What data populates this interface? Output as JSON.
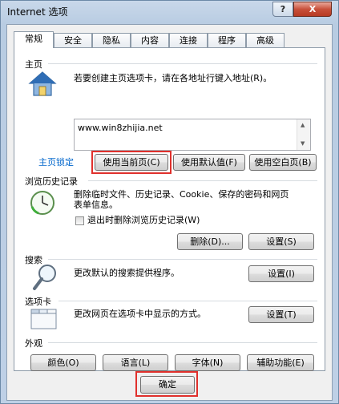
{
  "window": {
    "title": "Internet 选项",
    "help_label": "?",
    "close_label": "X"
  },
  "tabs": [
    {
      "label": "常规",
      "active": true
    },
    {
      "label": "安全"
    },
    {
      "label": "隐私"
    },
    {
      "label": "内容"
    },
    {
      "label": "连接"
    },
    {
      "label": "程序"
    },
    {
      "label": "高级"
    }
  ],
  "homepage": {
    "group_label": "主页",
    "description": "若要创建主页选项卡，请在各地址行键入地址(R)。",
    "url_value": "www.win8zhijia.net",
    "lock_label": "主页锁定",
    "use_current": "使用当前页(C)",
    "use_default": "使用默认值(F)",
    "use_blank": "使用空白页(B)",
    "icon": "house-icon"
  },
  "history": {
    "group_label": "浏览历史记录",
    "description_line1": "删除临时文件、历史记录、Cookie、保存的密码和网页",
    "description_line2": "表单信息。",
    "checkbox_label": "退出时删除浏览历史记录(W)",
    "delete_label": "删除(D)...",
    "settings_label": "设置(S)",
    "icon": "clock-icon"
  },
  "search": {
    "group_label": "搜索",
    "description": "更改默认的搜索提供程序。",
    "settings_label": "设置(I)",
    "icon": "magnifier-icon"
  },
  "tabs_section": {
    "group_label": "选项卡",
    "description": "更改网页在选项卡中显示的方式。",
    "settings_label": "设置(T)",
    "icon": "tabbed-window-icon"
  },
  "appearance": {
    "group_label": "外观",
    "colors": "颜色(O)",
    "languages": "语言(L)",
    "fonts": "字体(N)",
    "accessibility": "辅助功能(E)"
  },
  "footer": {
    "ok_label": "确定"
  },
  "colors": {
    "highlight": "#e0302c",
    "link": "#0066cc"
  }
}
